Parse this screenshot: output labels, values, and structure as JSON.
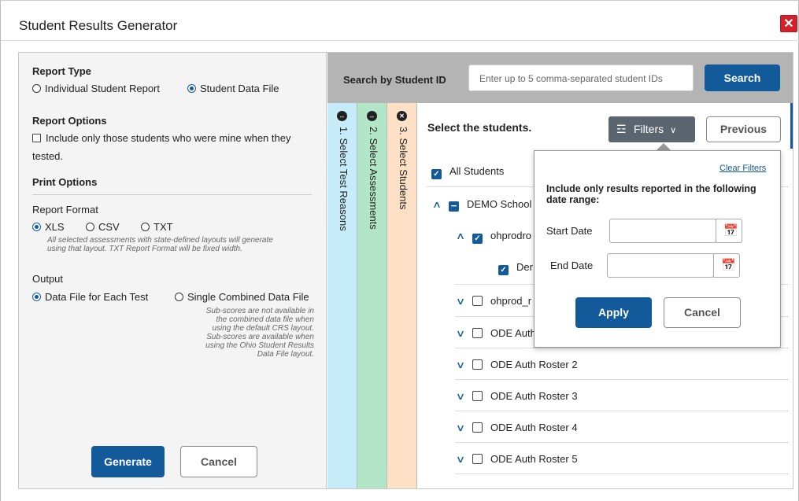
{
  "window": {
    "title": "Student Results Generator",
    "close_glyph": "✕"
  },
  "left": {
    "report_type": {
      "heading": "Report Type",
      "options": [
        "Individual Student Report",
        "Student Data File"
      ],
      "selected": "Student Data File"
    },
    "report_options": {
      "heading": "Report Options",
      "checkbox_label_line1": "Include only those students who were mine when they",
      "checkbox_label_line2": "tested.",
      "checked": false
    },
    "print_options": {
      "heading": "Print Options",
      "format_label": "Report Format",
      "formats": [
        "XLS",
        "CSV",
        "TXT"
      ],
      "selected_format": "XLS",
      "format_note_line1": "All selected assessments with state-defined layouts will generate",
      "format_note_line2": "using that layout. TXT Report Format will be fixed width.",
      "output_label": "Output",
      "outputs": [
        "Data File for Each Test",
        "Single Combined Data File"
      ],
      "selected_output": "Data File for Each Test",
      "output_note": [
        "Sub-scores are not available in",
        "the combined data file when",
        "using the default CRS layout.",
        "Sub-scores are available when",
        "using the Ohio Student Results",
        "Data File layout."
      ]
    },
    "generate_label": "Generate",
    "cancel_label": "Cancel"
  },
  "search": {
    "label": "Search by Student ID",
    "placeholder": "Enter up to 5 comma-separated student IDs",
    "button": "Search"
  },
  "steps": [
    {
      "label": "1. Select Test Reasons",
      "color": "#c6ecfa",
      "icon": "expand-icon"
    },
    {
      "label": "2. Select Assessments",
      "color": "#b3e6c8",
      "icon": "expand-icon"
    },
    {
      "label": "3. Select Students",
      "color": "#fde0c6",
      "icon": "close-icon"
    }
  ],
  "students": {
    "heading": "Select the students.",
    "filters_label": "Filters",
    "previous_label": "Previous",
    "all_label": "All Students",
    "rows": [
      {
        "label": "DEMO School",
        "state": "partial",
        "expanded": true
      },
      {
        "label": "ohprodro",
        "state": "checked",
        "expanded": true
      },
      {
        "label": "Der",
        "state": "checked"
      },
      {
        "label": "ohprod_r",
        "state": "unchecked",
        "expanded": false
      },
      {
        "label": "ODE Auth",
        "state": "unchecked",
        "expanded": false
      },
      {
        "label": "ODE Auth Roster 2",
        "state": "unchecked",
        "expanded": false
      },
      {
        "label": "ODE Auth Roster 3",
        "state": "unchecked",
        "expanded": false
      },
      {
        "label": "ODE Auth Roster 4",
        "state": "unchecked",
        "expanded": false
      },
      {
        "label": "ODE Auth Roster 5",
        "state": "unchecked",
        "expanded": false
      }
    ]
  },
  "filter_popover": {
    "clear_label": "Clear Filters",
    "description_line1": "Include only results reported in the following",
    "description_line2": "date range:",
    "start_label": "Start Date",
    "end_label": "End Date",
    "start_value": "",
    "end_value": "",
    "apply_label": "Apply",
    "cancel_label": "Cancel"
  },
  "colors": {
    "primary": "#135a9b",
    "close": "#d3202a",
    "filters_button": "#5b6570"
  }
}
